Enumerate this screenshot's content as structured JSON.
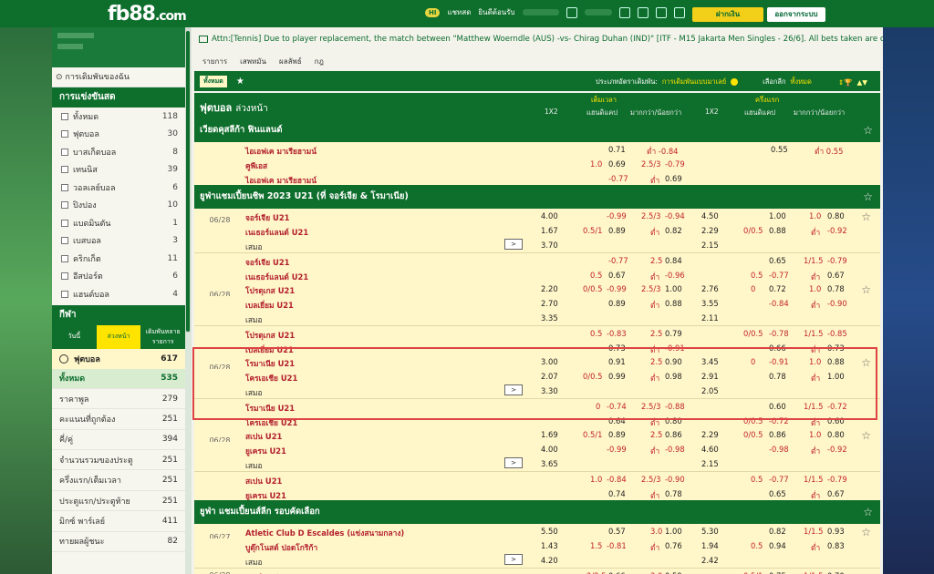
{
  "top": {
    "logo": "fb88",
    "logo_suffix": ".com",
    "chat": "แชทสด",
    "welcome": "ยินดีต้อนรับ",
    "deposit": "ฝากเงิน",
    "logout": "ออกจากระบบ"
  },
  "sidebar": {
    "fav": "การเดิมพันของฉัน",
    "live_head": "การแข่งขันสด",
    "sports": [
      {
        "n": "ทั้งหมด",
        "c": "118"
      },
      {
        "n": "ฟุตบอล",
        "c": "30"
      },
      {
        "n": "บาสเก็ตบอล",
        "c": "8"
      },
      {
        "n": "เทนนิส",
        "c": "39"
      },
      {
        "n": "วอลเลย์บอล",
        "c": "6"
      },
      {
        "n": "ปิงปอง",
        "c": "10"
      },
      {
        "n": "แบดมินตัน",
        "c": "1"
      },
      {
        "n": "เบสบอล",
        "c": "3"
      },
      {
        "n": "คริกเก็ต",
        "c": "11"
      },
      {
        "n": "อีสปอร์ต",
        "c": "6"
      },
      {
        "n": "แฮนด์บอล",
        "c": "4"
      }
    ],
    "sport_head": "กีฬา",
    "tabs": [
      "วันนี้",
      "ล่วงหน้า",
      "เดิมพันหลายรายการ"
    ],
    "football": {
      "n": "ฟุตบอล",
      "c": "617"
    },
    "markets": [
      {
        "n": "ทั้งหมด",
        "c": "535"
      },
      {
        "n": "ราคาพูล",
        "c": "279"
      },
      {
        "n": "คะแนนที่ถูกต้อง",
        "c": "251"
      },
      {
        "n": "คี่/คู่",
        "c": "394"
      },
      {
        "n": "จำนวนรวมของประตู",
        "c": "251"
      },
      {
        "n": "ครึ่งแรก/เต็มเวลา",
        "c": "251"
      },
      {
        "n": "ประตูแรก/ประตูท้าย",
        "c": "251"
      },
      {
        "n": "มิกซ์ พาร์เลย์",
        "c": "411"
      },
      {
        "n": "ทายผลผู้ชนะ",
        "c": "82"
      }
    ]
  },
  "main": {
    "ann": "Attn:[Tennis] Due to player replacement, the match between \"Matthew Woerndle (AUS) -vs- Chirag Duhan (IND)\" [ITF - M15 Jakarta Men Singles - 26/6]. All bets taken are considered",
    "tabs": [
      "รายการ",
      "เสพหมัน",
      "ผลลัพธ์",
      "กฎ"
    ],
    "filter": {
      "all": "ทั้งหมด",
      "type_l": "ประเภทอัตราเดิมพัน:",
      "type_v": "การเดิมพันแบบมาเลย์",
      "sel_l": "เลือกลีก",
      "sel_v": "ทั้งหมด"
    },
    "hdr": {
      "title": "ฟุตบอล",
      "sub": "ล่วงหน้า",
      "ft": "เต็มเวลา",
      "ht": "ครึ่งแรก",
      "c1": "1X2",
      "c2": "แฮนดิแคป",
      "c3": "มากกว่า/น้อยกว่า"
    },
    "leagues": [
      "เวียดคุสลีก้า ฟินแลนด์",
      "ยูฟ่าแชมเปี้ยนชิพ 2023 U21 (ที่ จอร์เจีย & โรมาเนีย)",
      "ยูฟ่า แชมเปี้ยนส์ลีก รอบคัดเลือก"
    ]
  }
}
